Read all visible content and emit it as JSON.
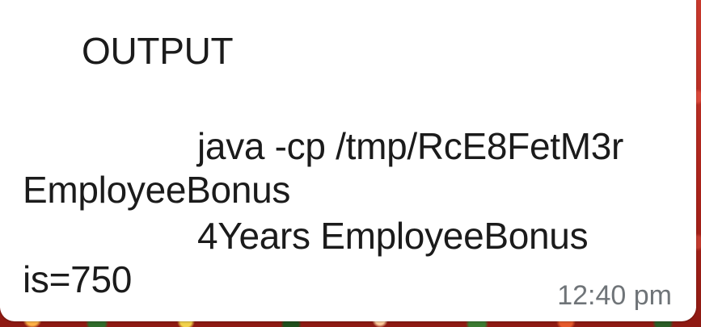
{
  "message": {
    "lines": [
      "OUTPUT",
      "java -cp /tmp/RcE8FetM3r",
      "EmployeeBonus",
      "4Years EmployeeBonus",
      "is=750"
    ],
    "time": "12:40 pm"
  },
  "colors": {
    "bubble_background": "#ffffff",
    "message_text": "#1b1b1b",
    "timestamp_text": "#6f7478",
    "wallpaper": "#b0271d"
  }
}
